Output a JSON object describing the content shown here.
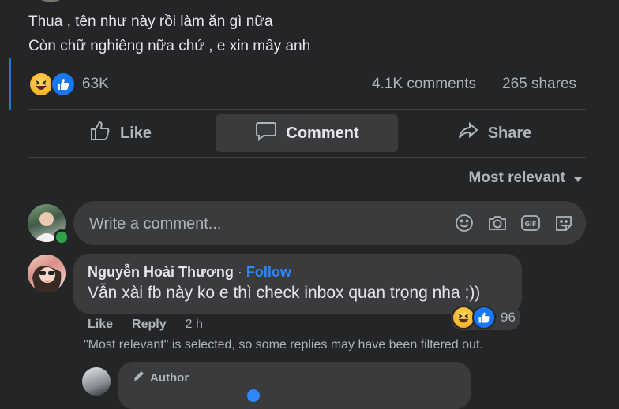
{
  "post": {
    "lines": [
      "Thua , tên như này rồi làm ăn gì nữa",
      "Còn chữ nghiêng nữa chứ , e xin mấy anh"
    ],
    "reactions_count": "63K",
    "comments_count": "4.1K comments",
    "shares_count": "265 shares"
  },
  "actions": {
    "like_label": "Like",
    "comment_label": "Comment",
    "share_label": "Share"
  },
  "sort": {
    "label": "Most relevant"
  },
  "composer": {
    "placeholder": "Write a comment...",
    "icons": [
      "emoji-icon",
      "camera-icon",
      "gif-icon",
      "sticker-icon"
    ]
  },
  "comment": {
    "author": "Nguyễn Hoài Thương",
    "separator": "·",
    "follow_label": "Follow",
    "text": "Vẫn xài fb này ko e thì check inbox quan trọng nha ;))",
    "reaction_count": "96",
    "like_label": "Like",
    "reply_label": "Reply",
    "time": "2 h"
  },
  "filter_note": "\"Most relevant\" is selected, so some replies may have been filtered out.",
  "reply": {
    "badge_label": "Author"
  },
  "colors": {
    "background": "#242526",
    "surface": "#3a3b3c",
    "text_primary": "#e4e6eb",
    "text_secondary": "#b0b3b8",
    "link": "#2d88ff",
    "like_blue": "#1877f2",
    "online": "#31a24c"
  }
}
